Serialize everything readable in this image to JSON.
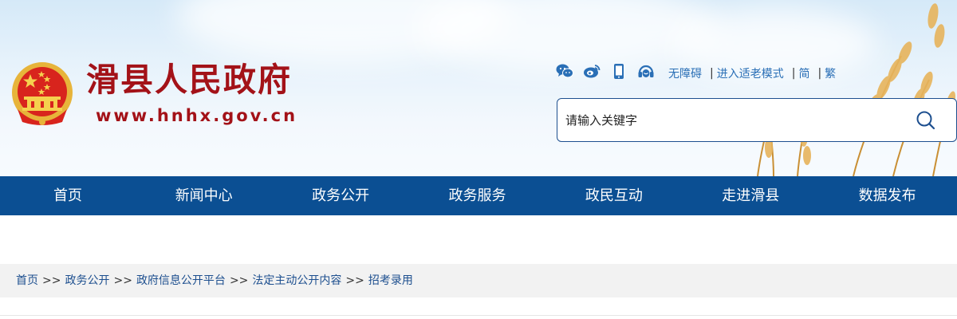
{
  "header": {
    "site_title": "滑县人民政府",
    "site_url": "www.hnhx.gov.cn",
    "social_icons": [
      "wechat-icon",
      "weibo-icon",
      "mobile-icon",
      "service-headset-icon"
    ],
    "tools": {
      "accessibility": "无障碍",
      "elder_mode": "进入适老模式",
      "simplified": "简",
      "traditional": "繁"
    },
    "search": {
      "placeholder": "请输入关键字"
    },
    "brand_color": "#a31218"
  },
  "nav": {
    "color": "#0b4f93",
    "items": [
      {
        "label": "首页"
      },
      {
        "label": "新闻中心"
      },
      {
        "label": "政务公开"
      },
      {
        "label": "政务服务"
      },
      {
        "label": "政民互动"
      },
      {
        "label": "走进滑县"
      },
      {
        "label": "数据发布"
      }
    ]
  },
  "breadcrumb": {
    "separator": ">>",
    "items": [
      {
        "label": "首页"
      },
      {
        "label": "政务公开"
      },
      {
        "label": "政府信息公开平台"
      },
      {
        "label": "法定主动公开内容"
      },
      {
        "label": "招考录用"
      }
    ]
  }
}
